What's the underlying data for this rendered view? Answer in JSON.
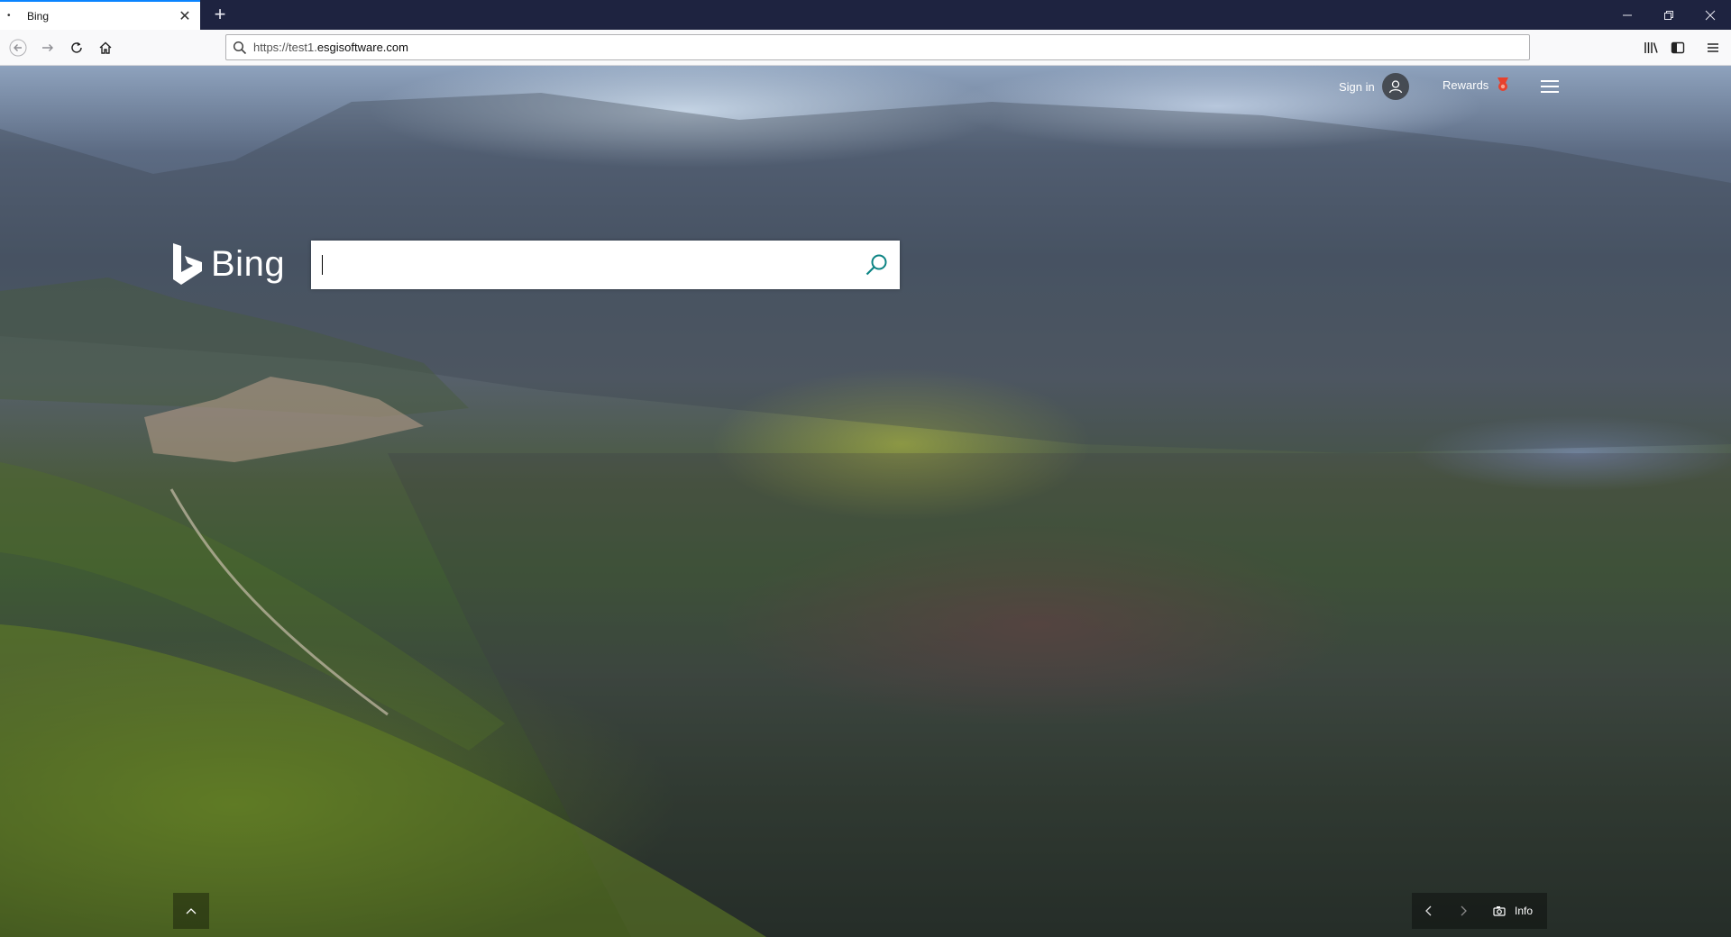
{
  "browser": {
    "tab": {
      "title": "Bing",
      "favicon": "dot-icon"
    },
    "new_tab_symbol": "+",
    "url": {
      "scheme": "https://test1.",
      "host": "esgisoftware.com"
    },
    "window_controls": {
      "minimize": "—",
      "restore": "❐",
      "close": "✕"
    }
  },
  "header": {
    "signin_label": "Sign in",
    "rewards_label": "Rewards"
  },
  "search": {
    "logo_text": "Bing",
    "value": "",
    "placeholder": ""
  },
  "footer": {
    "info_label": "Info"
  },
  "colors": {
    "accent": "#0a84ff",
    "tabbar": "#1e2340",
    "search_icon": "#0c8484",
    "rewards_badge": "#e8412c"
  }
}
